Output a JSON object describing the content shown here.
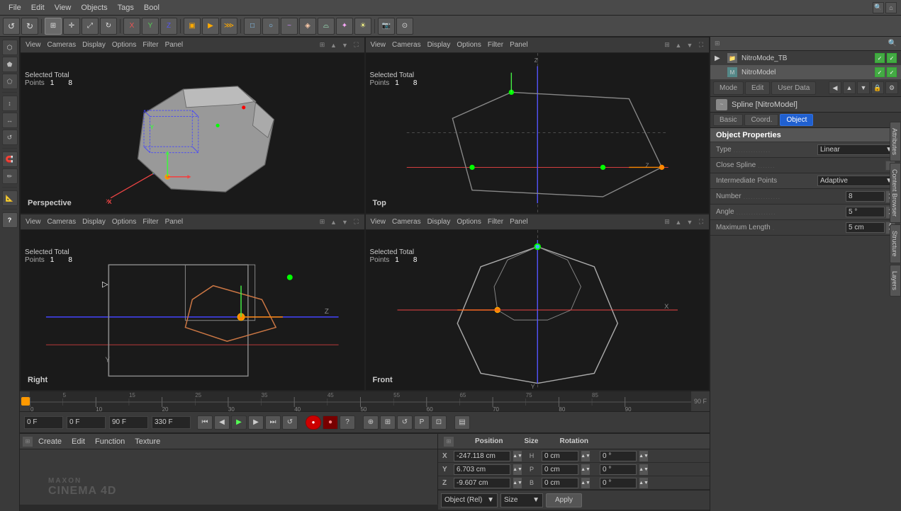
{
  "app": {
    "title": "Cinema 4D",
    "menu": [
      "File",
      "Edit",
      "View",
      "Objects",
      "Tags",
      "Bool"
    ]
  },
  "toolbar": {
    "undo": "↺",
    "redo": "↻"
  },
  "viewports": {
    "perspective": {
      "label": "Perspective",
      "menus": [
        "View",
        "Cameras",
        "Display",
        "Options",
        "Filter",
        "Panel"
      ],
      "selected_total": "Selected Total",
      "points_label": "Points",
      "points_value": "1",
      "total_value": "8"
    },
    "top": {
      "label": "Top",
      "menus": [
        "View",
        "Cameras",
        "Display",
        "Options",
        "Filter",
        "Panel"
      ],
      "selected_total": "Selected Total",
      "points_label": "Points",
      "points_value": "1",
      "total_value": "8"
    },
    "right": {
      "label": "Right",
      "menus": [
        "View",
        "Cameras",
        "Display",
        "Options",
        "Filter",
        "Panel"
      ],
      "selected_total": "Selected Total",
      "points_label": "Points",
      "points_value": "1",
      "total_value": "8"
    },
    "front": {
      "label": "Front",
      "menus": [
        "View",
        "Cameras",
        "Display",
        "Options",
        "Filter",
        "Panel"
      ],
      "selected_total": "Selected Total",
      "points_label": "Points",
      "points_value": "1",
      "total_value": "8"
    }
  },
  "timeline": {
    "current_frame": "0 F",
    "end_frame": "90 F",
    "ticks": [
      0,
      5,
      10,
      15,
      20,
      25,
      30,
      35,
      40,
      45,
      50,
      55,
      60,
      65,
      70,
      75,
      80,
      85,
      90
    ]
  },
  "playback": {
    "start_frame": "0 F",
    "current_frame": "0 F",
    "end_frame": "90 F",
    "range_end": "330 F"
  },
  "bottom_tabs": {
    "create": "Create",
    "edit": "Edit",
    "function": "Function",
    "texture": "Texture"
  },
  "transform": {
    "headers": {
      "position": "Position",
      "size": "Size",
      "rotation": "Rotation"
    },
    "x": {
      "pos": "-247.118 cm",
      "size": "0 cm",
      "size_label": "H",
      "rot": "0 °"
    },
    "y": {
      "pos": "6.703 cm",
      "size": "0 cm",
      "size_label": "P",
      "rot": "0 °"
    },
    "z": {
      "pos": "-9.607 cm",
      "size": "0 cm",
      "size_label": "B",
      "rot": "0 °"
    },
    "object_rel": "Object (Rel)",
    "size_btn": "Size",
    "apply_btn": "Apply"
  },
  "right_panel": {
    "mode_tab": "Mode",
    "edit_tab": "Edit",
    "user_data_tab": "User Data",
    "spline_label": "Spline [NitroModel]",
    "sub_tabs": {
      "basic": "Basic",
      "coord": "Coord.",
      "object": "Object"
    },
    "object_properties_title": "Object Properties",
    "properties": {
      "type_label": "Type",
      "type_dots": "...............",
      "type_value": "Linear",
      "close_spline_label": "Close Spline",
      "close_spline_dots": ".......",
      "intermediate_label": "Intermediate Points",
      "intermediate_dots": "",
      "intermediate_value": "Adaptive",
      "number_label": "Number",
      "number_dots": "...............",
      "number_value": "8",
      "angle_label": "Angle",
      "angle_dots": "................",
      "angle_value": "5 °",
      "max_length_label": "Maximum Length",
      "max_length_dots": ".",
      "max_length_value": "5 cm"
    },
    "objects": {
      "items": [
        {
          "name": "NitroMode_TB",
          "type": "folder",
          "vis1": true,
          "vis2": true
        },
        {
          "name": "NitroModel",
          "type": "model",
          "vis1": true,
          "vis2": true
        }
      ]
    },
    "side_tabs": [
      "Attributes",
      "Content Browser",
      "Structure",
      "Layers"
    ]
  }
}
